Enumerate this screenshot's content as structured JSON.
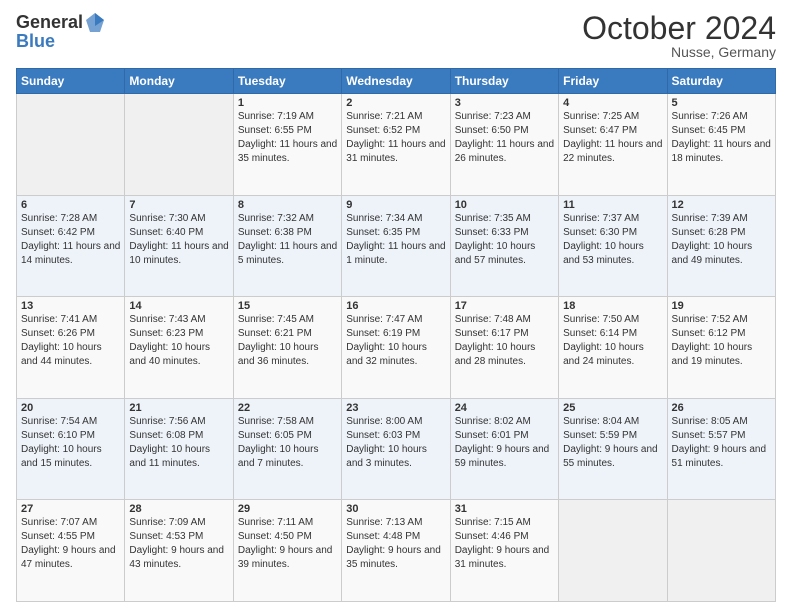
{
  "header": {
    "logo_general": "General",
    "logo_blue": "Blue",
    "month_title": "October 2024",
    "location": "Nusse, Germany"
  },
  "days_of_week": [
    "Sunday",
    "Monday",
    "Tuesday",
    "Wednesday",
    "Thursday",
    "Friday",
    "Saturday"
  ],
  "weeks": [
    [
      {
        "day": "",
        "sunrise": "",
        "sunset": "",
        "daylight": ""
      },
      {
        "day": "",
        "sunrise": "",
        "sunset": "",
        "daylight": ""
      },
      {
        "day": "1",
        "sunrise": "Sunrise: 7:19 AM",
        "sunset": "Sunset: 6:55 PM",
        "daylight": "Daylight: 11 hours and 35 minutes."
      },
      {
        "day": "2",
        "sunrise": "Sunrise: 7:21 AM",
        "sunset": "Sunset: 6:52 PM",
        "daylight": "Daylight: 11 hours and 31 minutes."
      },
      {
        "day": "3",
        "sunrise": "Sunrise: 7:23 AM",
        "sunset": "Sunset: 6:50 PM",
        "daylight": "Daylight: 11 hours and 26 minutes."
      },
      {
        "day": "4",
        "sunrise": "Sunrise: 7:25 AM",
        "sunset": "Sunset: 6:47 PM",
        "daylight": "Daylight: 11 hours and 22 minutes."
      },
      {
        "day": "5",
        "sunrise": "Sunrise: 7:26 AM",
        "sunset": "Sunset: 6:45 PM",
        "daylight": "Daylight: 11 hours and 18 minutes."
      }
    ],
    [
      {
        "day": "6",
        "sunrise": "Sunrise: 7:28 AM",
        "sunset": "Sunset: 6:42 PM",
        "daylight": "Daylight: 11 hours and 14 minutes."
      },
      {
        "day": "7",
        "sunrise": "Sunrise: 7:30 AM",
        "sunset": "Sunset: 6:40 PM",
        "daylight": "Daylight: 11 hours and 10 minutes."
      },
      {
        "day": "8",
        "sunrise": "Sunrise: 7:32 AM",
        "sunset": "Sunset: 6:38 PM",
        "daylight": "Daylight: 11 hours and 5 minutes."
      },
      {
        "day": "9",
        "sunrise": "Sunrise: 7:34 AM",
        "sunset": "Sunset: 6:35 PM",
        "daylight": "Daylight: 11 hours and 1 minute."
      },
      {
        "day": "10",
        "sunrise": "Sunrise: 7:35 AM",
        "sunset": "Sunset: 6:33 PM",
        "daylight": "Daylight: 10 hours and 57 minutes."
      },
      {
        "day": "11",
        "sunrise": "Sunrise: 7:37 AM",
        "sunset": "Sunset: 6:30 PM",
        "daylight": "Daylight: 10 hours and 53 minutes."
      },
      {
        "day": "12",
        "sunrise": "Sunrise: 7:39 AM",
        "sunset": "Sunset: 6:28 PM",
        "daylight": "Daylight: 10 hours and 49 minutes."
      }
    ],
    [
      {
        "day": "13",
        "sunrise": "Sunrise: 7:41 AM",
        "sunset": "Sunset: 6:26 PM",
        "daylight": "Daylight: 10 hours and 44 minutes."
      },
      {
        "day": "14",
        "sunrise": "Sunrise: 7:43 AM",
        "sunset": "Sunset: 6:23 PM",
        "daylight": "Daylight: 10 hours and 40 minutes."
      },
      {
        "day": "15",
        "sunrise": "Sunrise: 7:45 AM",
        "sunset": "Sunset: 6:21 PM",
        "daylight": "Daylight: 10 hours and 36 minutes."
      },
      {
        "day": "16",
        "sunrise": "Sunrise: 7:47 AM",
        "sunset": "Sunset: 6:19 PM",
        "daylight": "Daylight: 10 hours and 32 minutes."
      },
      {
        "day": "17",
        "sunrise": "Sunrise: 7:48 AM",
        "sunset": "Sunset: 6:17 PM",
        "daylight": "Daylight: 10 hours and 28 minutes."
      },
      {
        "day": "18",
        "sunrise": "Sunrise: 7:50 AM",
        "sunset": "Sunset: 6:14 PM",
        "daylight": "Daylight: 10 hours and 24 minutes."
      },
      {
        "day": "19",
        "sunrise": "Sunrise: 7:52 AM",
        "sunset": "Sunset: 6:12 PM",
        "daylight": "Daylight: 10 hours and 19 minutes."
      }
    ],
    [
      {
        "day": "20",
        "sunrise": "Sunrise: 7:54 AM",
        "sunset": "Sunset: 6:10 PM",
        "daylight": "Daylight: 10 hours and 15 minutes."
      },
      {
        "day": "21",
        "sunrise": "Sunrise: 7:56 AM",
        "sunset": "Sunset: 6:08 PM",
        "daylight": "Daylight: 10 hours and 11 minutes."
      },
      {
        "day": "22",
        "sunrise": "Sunrise: 7:58 AM",
        "sunset": "Sunset: 6:05 PM",
        "daylight": "Daylight: 10 hours and 7 minutes."
      },
      {
        "day": "23",
        "sunrise": "Sunrise: 8:00 AM",
        "sunset": "Sunset: 6:03 PM",
        "daylight": "Daylight: 10 hours and 3 minutes."
      },
      {
        "day": "24",
        "sunrise": "Sunrise: 8:02 AM",
        "sunset": "Sunset: 6:01 PM",
        "daylight": "Daylight: 9 hours and 59 minutes."
      },
      {
        "day": "25",
        "sunrise": "Sunrise: 8:04 AM",
        "sunset": "Sunset: 5:59 PM",
        "daylight": "Daylight: 9 hours and 55 minutes."
      },
      {
        "day": "26",
        "sunrise": "Sunrise: 8:05 AM",
        "sunset": "Sunset: 5:57 PM",
        "daylight": "Daylight: 9 hours and 51 minutes."
      }
    ],
    [
      {
        "day": "27",
        "sunrise": "Sunrise: 7:07 AM",
        "sunset": "Sunset: 4:55 PM",
        "daylight": "Daylight: 9 hours and 47 minutes."
      },
      {
        "day": "28",
        "sunrise": "Sunrise: 7:09 AM",
        "sunset": "Sunset: 4:53 PM",
        "daylight": "Daylight: 9 hours and 43 minutes."
      },
      {
        "day": "29",
        "sunrise": "Sunrise: 7:11 AM",
        "sunset": "Sunset: 4:50 PM",
        "daylight": "Daylight: 9 hours and 39 minutes."
      },
      {
        "day": "30",
        "sunrise": "Sunrise: 7:13 AM",
        "sunset": "Sunset: 4:48 PM",
        "daylight": "Daylight: 9 hours and 35 minutes."
      },
      {
        "day": "31",
        "sunrise": "Sunrise: 7:15 AM",
        "sunset": "Sunset: 4:46 PM",
        "daylight": "Daylight: 9 hours and 31 minutes."
      },
      {
        "day": "",
        "sunrise": "",
        "sunset": "",
        "daylight": ""
      },
      {
        "day": "",
        "sunrise": "",
        "sunset": "",
        "daylight": ""
      }
    ]
  ]
}
